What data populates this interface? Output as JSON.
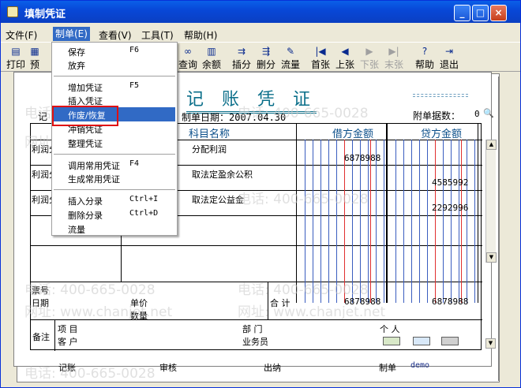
{
  "window": {
    "title": "填制凭证"
  },
  "menubar": [
    {
      "label": "文件(F)"
    },
    {
      "label": "制单(E)"
    },
    {
      "label": "查看(V)"
    },
    {
      "label": "工具(T)"
    },
    {
      "label": "帮助(H)"
    }
  ],
  "toolbar": [
    {
      "label": "打印",
      "icon": "printer-icon"
    },
    {
      "label": "预",
      "icon": "preview-icon"
    },
    {
      "label": "查询",
      "icon": "binoculars-icon"
    },
    {
      "label": "余额",
      "icon": "chart-icon"
    },
    {
      "label": "插分",
      "icon": "insert-row-icon"
    },
    {
      "label": "删分",
      "icon": "delete-row-icon"
    },
    {
      "label": "流量",
      "icon": "flow-icon"
    },
    {
      "label": "首张",
      "icon": "first-icon"
    },
    {
      "label": "上张",
      "icon": "prev-icon"
    },
    {
      "label": "下张",
      "icon": "next-icon"
    },
    {
      "label": "末张",
      "icon": "last-icon"
    },
    {
      "label": "帮助",
      "icon": "help-icon"
    },
    {
      "label": "退出",
      "icon": "exit-icon"
    }
  ],
  "dropdown": {
    "items": [
      {
        "label": "保存",
        "shortcut": "F6"
      },
      {
        "label": "放弃",
        "shortcut": ""
      },
      {
        "label": "增加凭证",
        "shortcut": "F5"
      },
      {
        "label": "插入凭证",
        "shortcut": ""
      },
      {
        "label": "作废/恢复",
        "shortcut": ""
      },
      {
        "label": "冲销凭证",
        "shortcut": ""
      },
      {
        "label": "整理凭证",
        "shortcut": ""
      },
      {
        "label": "调用常用凭证",
        "shortcut": "F4"
      },
      {
        "label": "生成常用凭证",
        "shortcut": ""
      },
      {
        "label": "插入分录",
        "shortcut": "Ctrl+I"
      },
      {
        "label": "删除分录",
        "shortcut": "Ctrl+D"
      },
      {
        "label": "流量",
        "shortcut": ""
      }
    ]
  },
  "voucher": {
    "title": "记 账 凭 证",
    "type_label": "记",
    "date_label": "制单日期：2007.04.30",
    "attach_label": "附单据数：",
    "attach_value": "0",
    "col_subject": "科目名称",
    "col_debit": "借方金额",
    "col_credit": "贷方金额",
    "rows": [
      {
        "summary": "利润分",
        "subject": "分配利润",
        "debit": "6878988",
        "credit": ""
      },
      {
        "summary": "利润分",
        "subject": "取法定盈余公积",
        "debit": "",
        "credit": "4585992"
      },
      {
        "summary": "利润分",
        "subject": "取法定公益金",
        "debit": "",
        "credit": "2292996"
      }
    ],
    "bill_no": "票号",
    "date": "日期",
    "unit_price": "单价",
    "quantity": "数量",
    "total_label": "合 计",
    "total_debit": "6878988",
    "total_credit": "6878988",
    "remark": "备注",
    "project": "项  目",
    "department": "部  门",
    "person": "个  人",
    "customer": "客  户",
    "salesman": "业务员",
    "bookkeeper": "记账",
    "auditor": "审核",
    "cashier": "出纳",
    "maker": "制单",
    "maker_name": "demo"
  },
  "watermark": {
    "phone": "电话: 400-665-0028",
    "site": "网址: www.chanjet.net"
  },
  "colors": {
    "title_teal": "#0b6f8a",
    "highlight": "#316ac5",
    "red_box": "#e01010"
  }
}
